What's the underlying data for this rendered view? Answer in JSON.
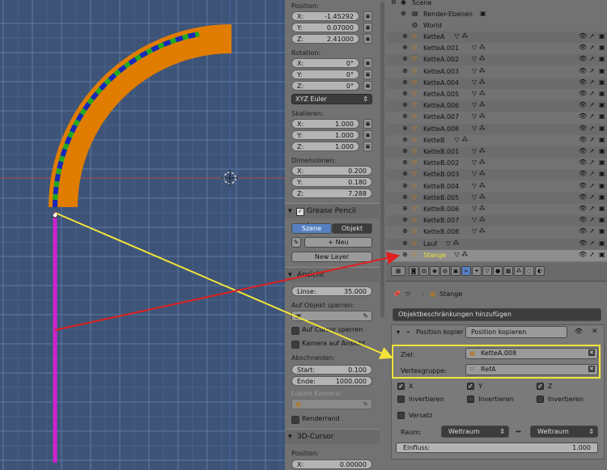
{
  "colors": {
    "viewport_bg": "#3d5478",
    "panel_bg": "#727272",
    "accent": "#5680c2",
    "orange": "#e07c00",
    "magenta": "#cc22cc",
    "yellow": "#f2e33a",
    "red": "#e02020"
  },
  "npanel": {
    "position_label": "Position:",
    "position": [
      {
        "k": "X:",
        "v": "-1.45292"
      },
      {
        "k": "Y:",
        "v": "0.07000"
      },
      {
        "k": "Z:",
        "v": "2.41000"
      }
    ],
    "rotation_label": "Rotation:",
    "rotation": [
      {
        "k": "X:",
        "v": "0°"
      },
      {
        "k": "Y:",
        "v": "0°"
      },
      {
        "k": "Z:",
        "v": "0°"
      }
    ],
    "rotation_mode": "XYZ Euler",
    "scale_label": "Skalieren:",
    "scale": [
      {
        "k": "X:",
        "v": "1.000"
      },
      {
        "k": "Y:",
        "v": "1.000"
      },
      {
        "k": "Z:",
        "v": "1.000"
      }
    ],
    "dimensions_label": "Dimensionen:",
    "dimensions": [
      {
        "k": "X:",
        "v": "0.200"
      },
      {
        "k": "Y:",
        "v": "0.180"
      },
      {
        "k": "Z:",
        "v": "7.288"
      }
    ],
    "grease_header": "Grease Pencil Layers",
    "grease_tab_scene": "Szene",
    "grease_tab_object": "Objekt",
    "grease_new": "Neu",
    "grease_new_layer": "New Layer",
    "view_header": "Ansicht",
    "lens_label": "Linse:",
    "lens_value": "35.000",
    "lock_label": "Auf Objekt sperren:",
    "lock_cursor": "Auf Cursor sperren",
    "lock_camera": "Kamera auf Ansicht",
    "clip_label": "Abschneiden:",
    "clip_start_k": "Start:",
    "clip_start_v": "0.100",
    "clip_end_k": "Ende:",
    "clip_end_v": "1000.000",
    "local_camera": "Lokale Kamera:",
    "render_border": "Renderrand",
    "cursor_header": "3D-Cursor",
    "cursor_pos_label": "Position:",
    "cursor_x_k": "X:",
    "cursor_x_v": "0.00000"
  },
  "outliner": {
    "scene": "Scene",
    "render_layers": "Render-Ebenen",
    "world": "World",
    "objects": [
      "KetteA",
      "KetteA.001",
      "KetteA.002",
      "KetteA.003",
      "KetteA.004",
      "KetteA.005",
      "KetteA.006",
      "KetteA.007",
      "KetteA.008",
      "KetteB",
      "KetteB.001",
      "KetteB.002",
      "KetteB.003",
      "KetteB.004",
      "KetteB.005",
      "KetteB.006",
      "KetteB.007",
      "KetteB.008",
      "Lauf",
      "Stange"
    ]
  },
  "properties": {
    "object_name": "Stange",
    "add_constraint": "Objektbeschränkungen hinzufügen",
    "constraint_type": "Position kopier",
    "constraint_name": "Position kopieren",
    "target_label": "Ziel:",
    "target_value": "KetteA.008",
    "vgroup_label": "Vertexgruppe:",
    "vgroup_value": "RefA",
    "axis_x": "X",
    "axis_y": "Y",
    "axis_z": "Z",
    "invert": "Invertieren",
    "offset": "Versatz",
    "space_label": "Raum:",
    "space_owner": "Weltraum",
    "space_target": "Weltraum",
    "influence_label": "Einfluss:",
    "influence_value": "1.000"
  }
}
